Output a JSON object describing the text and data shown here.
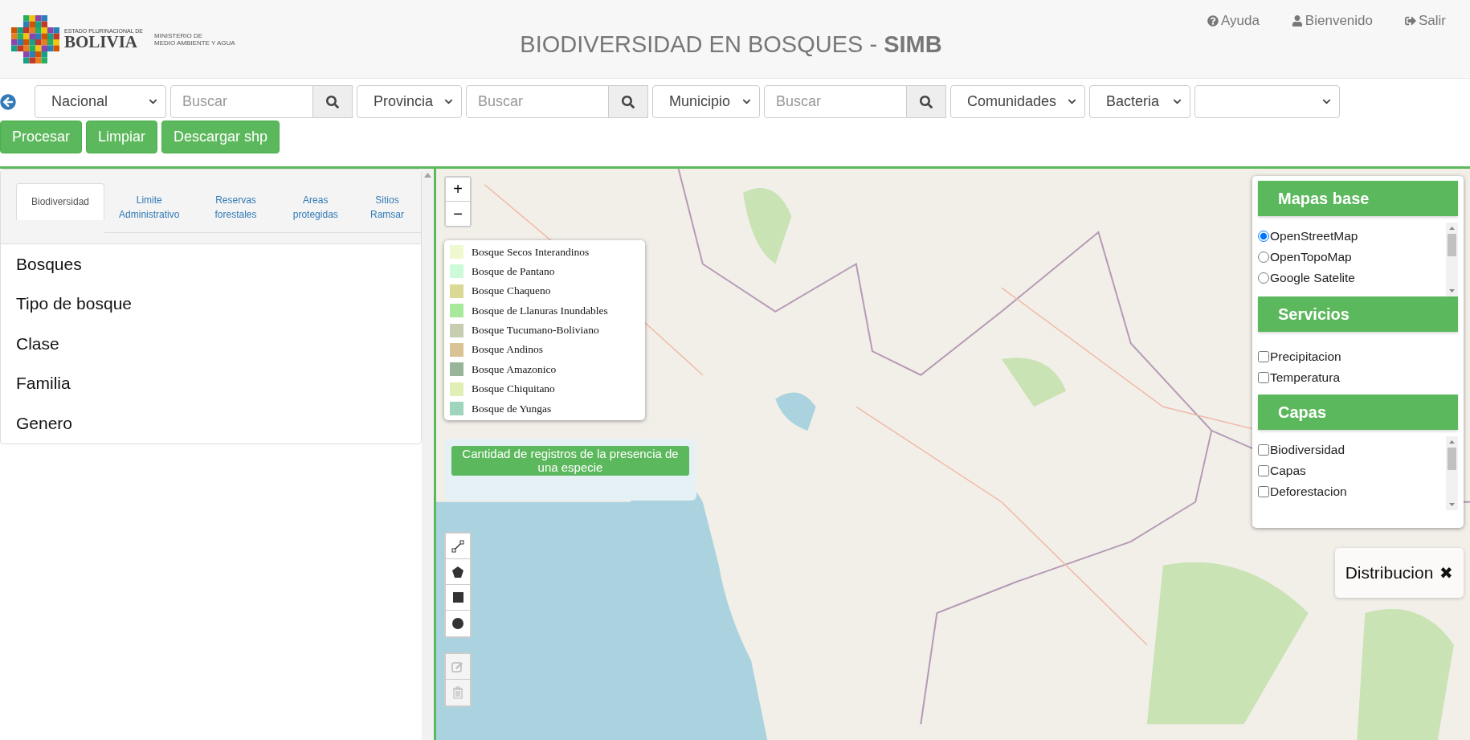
{
  "header": {
    "logo": {
      "top": "ESTADO PLURINACIONAL DE",
      "name": "BOLIVIA",
      "ministry": [
        "MINISTERIO DE",
        "MEDIO AMBIENTE Y AGUA"
      ]
    },
    "title": "BIODIVERSIDAD EN BOSQUES - **SIMB**",
    "nav": [
      {
        "kind": "help",
        "label": "Ayuda"
      },
      {
        "kind": "user",
        "label": "Bienvenido"
      },
      {
        "kind": "exit",
        "label": "Salir"
      }
    ]
  },
  "filters": [
    {
      "kind": "select",
      "value": "Nacional"
    },
    {
      "kind": "search",
      "placeholder": "Buscar"
    },
    {
      "kind": "select",
      "value": "Provincia"
    },
    {
      "kind": "search",
      "placeholder": "Buscar"
    },
    {
      "kind": "select",
      "value": "Municipio"
    },
    {
      "kind": "search",
      "placeholder": "Buscar"
    },
    {
      "kind": "select",
      "value": "Comunidades"
    },
    {
      "kind": "select",
      "value": "Bacteria"
    },
    {
      "kind": "select"
    }
  ],
  "actions": [
    "Procesar",
    "Limpiar",
    "Descargar shp"
  ],
  "sidebar": {
    "tabs": [
      {
        "label": "Biodiversidad",
        "selected": true
      },
      {
        "label": "Limite Administrativo",
        "selected": false
      },
      {
        "label": "Reservas forestales",
        "selected": false
      },
      {
        "label": "Areas protegidas",
        "selected": false
      },
      {
        "label": "Sitios Ramsar",
        "selected": false
      }
    ],
    "items": [
      "Bosques",
      "Tipo de bosque",
      "Clase",
      "Familia",
      "Genero"
    ]
  },
  "map": {
    "zoom": [
      "+",
      "−"
    ],
    "legend": [
      {
        "label": "Bosque Secos Interandinos",
        "color": "#eef9cf"
      },
      {
        "label": "Bosque de Pantano",
        "color": "#cdfbd9"
      },
      {
        "label": "Bosque Chaqueno",
        "color": "#dcd994"
      },
      {
        "label": "Bosque de Llanuras Inundables",
        "color": "#a9e99c"
      },
      {
        "label": "Bosque Tucumano-Boliviano",
        "color": "#c7cdb0"
      },
      {
        "label": "Bosque Andinos",
        "color": "#d9c395"
      },
      {
        "label": "Bosque Amazonico",
        "color": "#98b59a"
      },
      {
        "label": "Bosque Chiquitano",
        "color": "#e0efb5"
      },
      {
        "label": "Bosque de Yungas",
        "color": "#9fd4bd"
      }
    ],
    "info_title": "Cantidad de registros de la presencia de una especie",
    "layers": [
      {
        "title": "Mapas base",
        "kind": "radio",
        "scroll": true,
        "items": [
          {
            "label": "OpenStreetMap",
            "selected": true
          },
          {
            "label": "OpenTopoMap",
            "selected": false
          },
          {
            "label": "Google Satelite",
            "selected": false
          }
        ]
      },
      {
        "title": "Servicios",
        "kind": "check",
        "scroll": false,
        "items": [
          {
            "label": "Precipitacion",
            "checked": false
          },
          {
            "label": "Temperatura",
            "checked": false
          }
        ]
      },
      {
        "title": "Capas",
        "kind": "check",
        "scroll": true,
        "items": [
          {
            "label": "Biodiversidad",
            "checked": false
          },
          {
            "label": "Capas",
            "checked": false
          },
          {
            "label": "Deforestacion",
            "checked": false
          }
        ]
      }
    ],
    "distribution": {
      "label": "Distribucion",
      "close": "✖"
    }
  }
}
